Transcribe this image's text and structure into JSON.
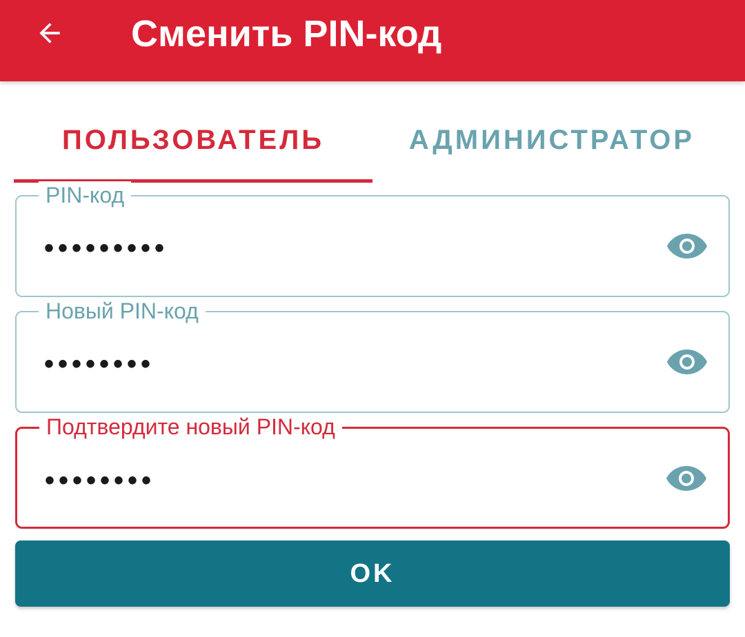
{
  "appbar": {
    "title": "Сменить PIN-код",
    "back_icon": "arrow-left-icon",
    "background_color": "#dc2033"
  },
  "tabs": [
    {
      "label": "ПОЛЬЗОВАТЕЛЬ",
      "selected": true
    },
    {
      "label": "АДМИНИСТРАТОР",
      "selected": false
    }
  ],
  "fields": [
    {
      "label": "PIN-код",
      "value": "•••••••••",
      "icon": "eye-icon",
      "state": "normal"
    },
    {
      "label": "Новый PIN-код",
      "value": "••••••••",
      "icon": "eye-icon",
      "state": "normal"
    },
    {
      "label": "Подтвердите новый PIN-код",
      "value": "••••••••",
      "icon": "eye-icon",
      "state": "error"
    }
  ],
  "ok_button": {
    "label": "OK",
    "color": "#137486"
  },
  "colors": {
    "accent_red": "#d42a3b",
    "muted_teal": "#6aa3ae",
    "field_border": "#9ec6cd"
  }
}
